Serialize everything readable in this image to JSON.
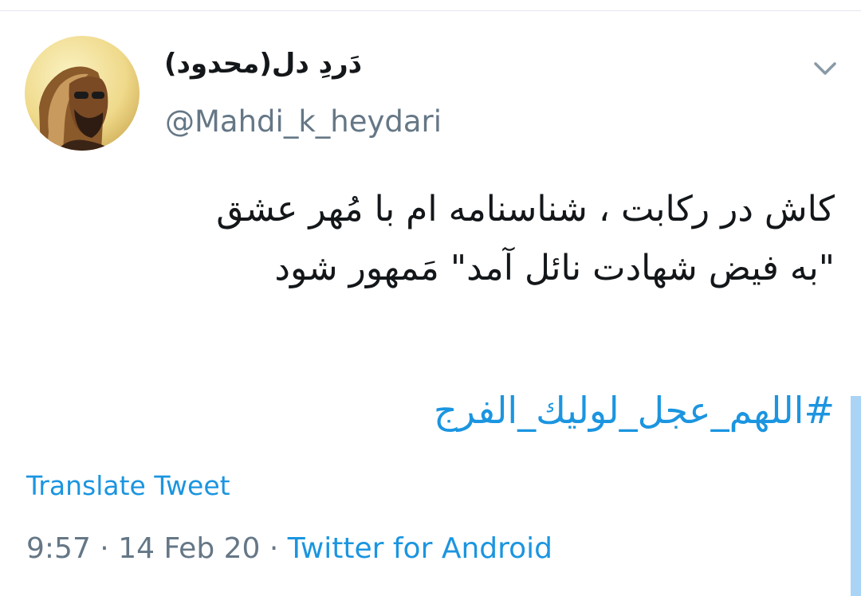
{
  "tweet": {
    "author": {
      "display_name": "دَردِ دل(محدود)",
      "handle": "@Mahdi_k_heydari",
      "avatar_icon": "avatar-photo"
    },
    "text_lines": [
      "کاش در رکابت ، شناسنامه ام با مُهر عشق",
      "\"به فیض شهادت نائل آمد\" مَمهور شود"
    ],
    "hashtag": "#اللهم_عجل_لولیك_الفرج",
    "translate_label": "Translate Tweet",
    "time": "9:57",
    "separator": " · ",
    "date": "14 Feb 20",
    "source": "Twitter for Android",
    "menu_icon": "chevron-down-icon"
  },
  "colors": {
    "link": "#1b95e0",
    "secondary_text": "#657786",
    "primary_text": "#14171a",
    "divider": "#e1e8ed"
  }
}
